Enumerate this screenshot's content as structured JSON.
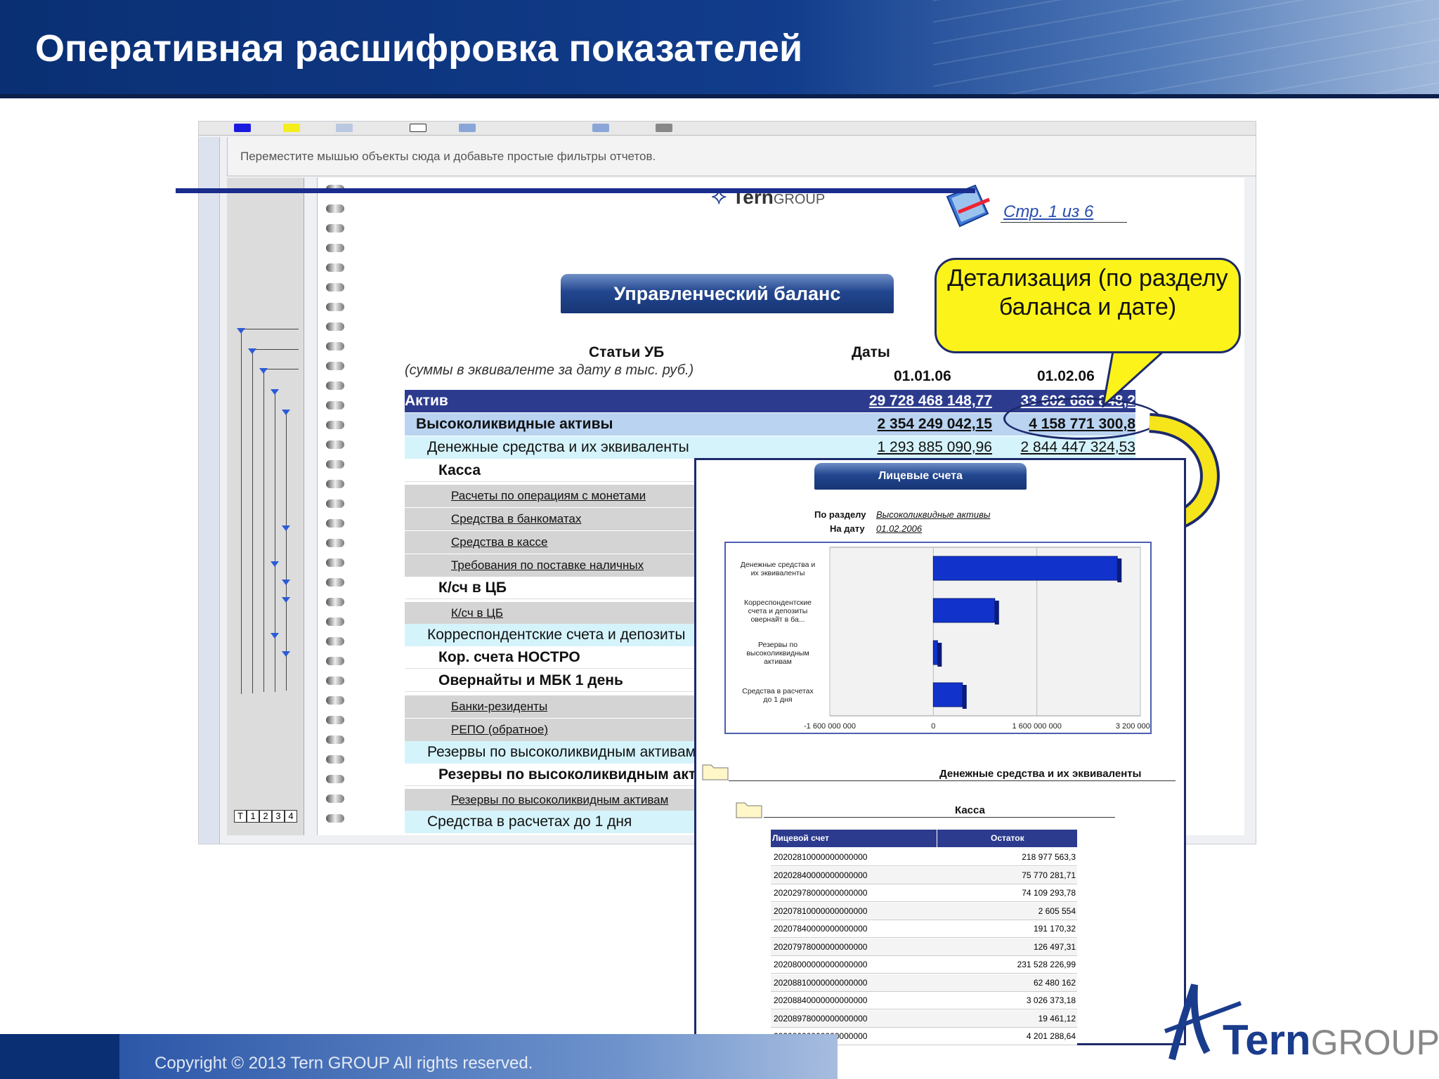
{
  "slide": {
    "title": "Оперативная расшифровка показателей",
    "copyright": "Copyright © 2013 Tern GROUP All rights reserved.",
    "footer_logo": {
      "brand": "Tern",
      "suffix": "GROUP"
    }
  },
  "app": {
    "filter_hint": "Переместите мышью объекты сюда и добавьте простые фильтры отчетов.",
    "level_buttons": [
      "T",
      "1",
      "2",
      "3",
      "4"
    ]
  },
  "report": {
    "logo": {
      "brand": "Tern",
      "suffix": "GROUP"
    },
    "page_label": "Стр. 1 из 6",
    "banner": "Управленческий баланс",
    "col_header_items": "Статьи УБ",
    "col_header_note": "(суммы в эквиваленте за дату в тыс. руб.)",
    "col_header_dates": "Даты",
    "date1": "01.01.06",
    "date2": "01.02.06",
    "rows": [
      {
        "label": "Актив",
        "v1": "29 728 468 148,77",
        "v2": "33 602 686 848,2"
      },
      {
        "label": "Высоколиквидные активы",
        "v1": "2 354 249 042,15",
        "v2": "4 158 771 300,8"
      },
      {
        "label": "Денежные средства и их эквиваленты",
        "v1": "1 293 885 090,96",
        "v2": "2 844 447 324,53"
      },
      {
        "label": "Касса"
      },
      {
        "label": "Расчеты по операциям с монетами"
      },
      {
        "label": "Средства в банкоматах"
      },
      {
        "label": "Средства в кассе"
      },
      {
        "label": "Требования по поставке наличных"
      },
      {
        "label": "К/сч в ЦБ"
      },
      {
        "label": "К/сч в ЦБ"
      },
      {
        "label": "Корреспондентские счета и депозиты"
      },
      {
        "label": "Кор. счета НОСТРО"
      },
      {
        "label": "Овернайты и МБК 1 день"
      },
      {
        "label": "Банки-резиденты"
      },
      {
        "label": "РЕПО (обратное)"
      },
      {
        "label": "Резервы по высоколиквидным активам"
      },
      {
        "label": "Резервы по высоколиквидным активам"
      },
      {
        "label": "Резервы по высоколиквидным активам"
      },
      {
        "label": "Средства в расчетах до 1 дня"
      }
    ]
  },
  "callout": {
    "text": "Детализация (по разделу баланса и дате)"
  },
  "popup": {
    "banner": "Лицевые счета",
    "section_label": "По разделу",
    "section_value": "Высоколиквидные активы",
    "date_label": "На дату",
    "date_value": "01.02.2006",
    "folder1": "Денежные средства и их эквиваленты",
    "folder2": "Касса",
    "table_headers": [
      "Лицевой счет",
      "Остаток"
    ],
    "table_rows": [
      [
        "20202810000000000000",
        "218 977 563,3"
      ],
      [
        "20202840000000000000",
        "75 770 281,71"
      ],
      [
        "20202978000000000000",
        "74 109 293,78"
      ],
      [
        "20207810000000000000",
        "2 605 554"
      ],
      [
        "20207840000000000000",
        "191 170,32"
      ],
      [
        "20207978000000000000",
        "126 497,31"
      ],
      [
        "20208000000000000000",
        "231 528 226,99"
      ],
      [
        "20208810000000000000",
        "62 480 162"
      ],
      [
        "20208840000000000000",
        "3 026 373,18"
      ],
      [
        "20208978000000000000",
        "19 461,12"
      ],
      [
        "20209000000000000000",
        "4 201 288,64"
      ]
    ]
  },
  "chart_data": {
    "type": "bar",
    "orientation": "horizontal",
    "categories": [
      "Денежные средства и их эквиваленты",
      "Корреспондентские счета и депозиты овернайт в ба...",
      "Резервы по высоколиквидным активам",
      "Средства в расчетах до 1 дня"
    ],
    "values": [
      2844447324,
      950000000,
      60000000,
      450000000
    ],
    "xlim": [
      -1600000000,
      3200000000
    ],
    "ticks": [
      "-1 600 000 000",
      "0",
      "1 600 000 000",
      "3 200 000 000"
    ],
    "bar_color": "#1133cc",
    "grid": true
  }
}
